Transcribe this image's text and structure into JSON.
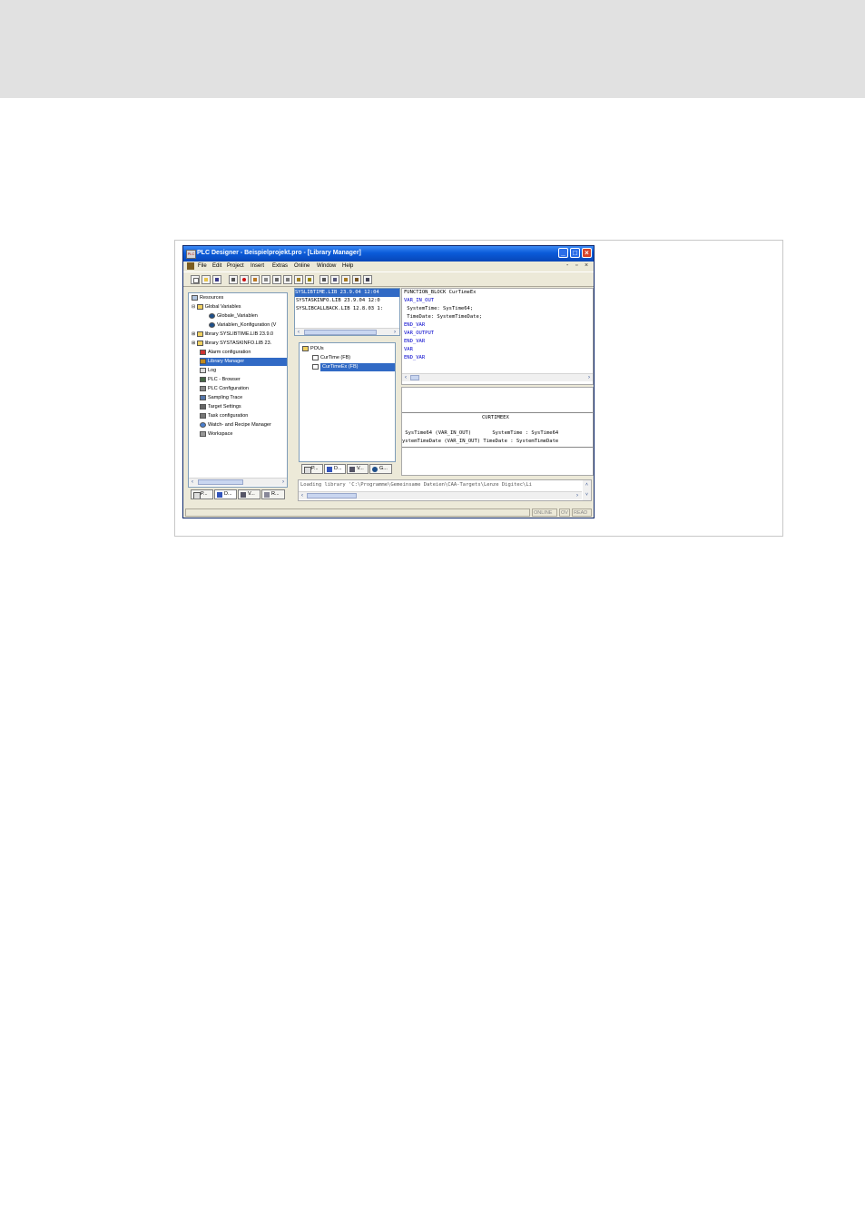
{
  "window": {
    "title": "PLC Designer - Beispielprojekt.pro - [Library Manager]",
    "app_icon_label": "PLC"
  },
  "menu": {
    "items": [
      "File",
      "Edit",
      "Project",
      "Insert",
      "Extras",
      "Online",
      "Window",
      "Help"
    ]
  },
  "object_tree": {
    "items": [
      {
        "label": "Resources",
        "icon": "resources-icon"
      },
      {
        "label": "Global Variables",
        "icon": "folder-icon"
      },
      {
        "label": "Globale_Variablen",
        "icon": "globe-icon"
      },
      {
        "label": "Variablen_Konfiguration (V",
        "icon": "globe-icon"
      },
      {
        "label": "library SYSLIBTIME.LIB 23.9.0",
        "icon": "folder-icon"
      },
      {
        "label": "library SYSTASKINFO.LIB 23.",
        "icon": "folder-icon"
      },
      {
        "label": "Alarm configuration",
        "icon": "alarm-icon"
      },
      {
        "label": "Library Manager",
        "icon": "library-icon"
      },
      {
        "label": "Log",
        "icon": "log-icon"
      },
      {
        "label": "PLC - Browser",
        "icon": "browser-icon"
      },
      {
        "label": "PLC Configuration",
        "icon": "config-icon"
      },
      {
        "label": "Sampling Trace",
        "icon": "trace-icon"
      },
      {
        "label": "Target Settings",
        "icon": "target-icon"
      },
      {
        "label": "Task configuration",
        "icon": "task-icon"
      },
      {
        "label": "Watch- and Recipe Manager",
        "icon": "watch-icon"
      },
      {
        "label": "Workspace",
        "icon": "workspace-icon"
      }
    ],
    "selected": "Library Manager",
    "tabs": [
      "P...",
      "D...",
      "V...",
      "R..."
    ]
  },
  "libraries": {
    "items": [
      "SYSLIBTIME.LIB 23.9.04 12:04",
      "SYSTASKINFO.LIB 23.9.04 12:0",
      "SYSLIBCALLBACK.LIB 12.8.03 1:"
    ],
    "selected": "SYSLIBTIME.LIB 23.9.04 12:04"
  },
  "pou_tree": {
    "root": "POUs",
    "items": [
      "CurTime (FB)",
      "CurTimeEx (FB)"
    ],
    "selected": "CurTimeEx (FB)",
    "tabs": [
      "P...",
      "D...",
      "V...",
      "G..."
    ]
  },
  "declaration": {
    "lines": [
      {
        "text": "FUNCTION_BLOCK CurTimeEx",
        "kw": false
      },
      {
        "text": "VAR_IN_OUT",
        "kw": true
      },
      {
        "text": " SystemTime: SysTime64;",
        "kw": false
      },
      {
        "text": " TimeDate: SystemTimeDate;",
        "kw": false
      },
      {
        "text": "END_VAR",
        "kw": true
      },
      {
        "text": "VAR_OUTPUT",
        "kw": true
      },
      {
        "text": "END_VAR",
        "kw": true
      },
      {
        "text": "VAR",
        "kw": true
      },
      {
        "text": "END_VAR",
        "kw": true
      }
    ]
  },
  "graphic": {
    "block_name": "CURTIMEEX",
    "row1": " SysTime64 (VAR_IN_OUT)       SystemTime : SysTime64",
    "row2": "ystemTimeDate (VAR_IN_OUT) TimeDate : SystemTimeDate"
  },
  "message": {
    "text": "Loading library 'C:\\Programme\\Gemeinsame Dateien\\CAA-Targets\\Lenze Digitec\\Li"
  },
  "status": {
    "online": "ONLINE",
    "ov": "OV",
    "read": "READ"
  },
  "colors": {
    "titlebar": "#0a5bd9",
    "selection": "#316ac5",
    "keyword": "#0000cc",
    "window_bg": "#ece9d8"
  }
}
